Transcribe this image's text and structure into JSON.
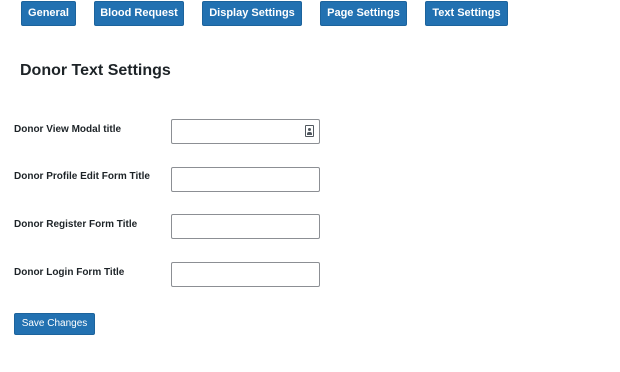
{
  "tabs": [
    {
      "label": "General"
    },
    {
      "label": "Blood Request"
    },
    {
      "label": "Display Settings"
    },
    {
      "label": "Page Settings"
    },
    {
      "label": "Text Settings"
    }
  ],
  "page_title": "Donor Text Settings",
  "fields": [
    {
      "label": "Donor View Modal title",
      "value": "",
      "icon": "contact-card-icon"
    },
    {
      "label": "Donor Profile Edit Form Title",
      "value": ""
    },
    {
      "label": "Donor Register Form Title",
      "value": ""
    },
    {
      "label": "Donor Login Form Title",
      "value": ""
    }
  ],
  "save_button_label": "Save Changes",
  "colors": {
    "accent": "#2271b1",
    "text": "#1d2327",
    "input_border": "#8c8f94"
  }
}
